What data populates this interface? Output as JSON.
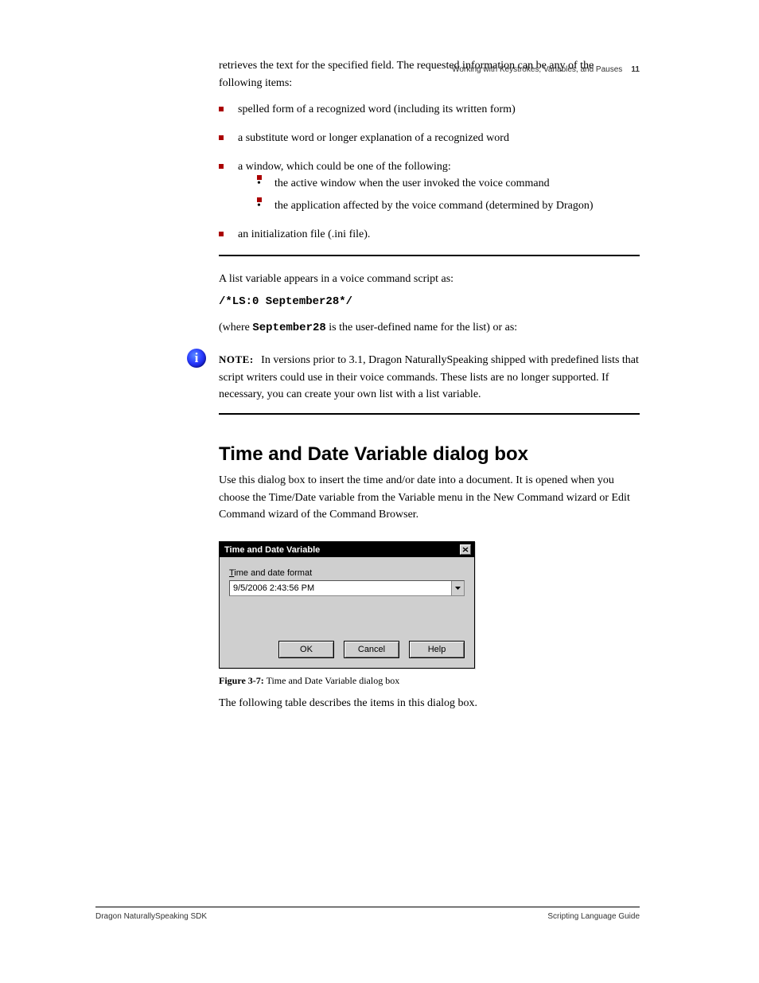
{
  "header": {
    "runner": "Working with Keystrokes, Variables, and Pauses",
    "page_number": "11"
  },
  "intro_para": "retrieves the text for the specified field. The requested information can be any of the following items:",
  "bullets_level1": [
    "spelled form of a recognized word (including its written form)",
    "a substitute word or longer explanation of a recognized word",
    "a window, which could be one of the following:"
  ],
  "bullets_level2": [
    "the active window when the user invoked the voice command",
    "the application affected by the voice command (determined by Dragon)"
  ],
  "bullet_last": "an initialization file (.ini file).",
  "list_variable_para_1": "A list variable appears in a voice command script as:",
  "list_variable_code_1": "/*LS:0 September28*/",
  "list_variable_para_2_before": "(where ",
  "list_variable_para_2_code": "September28",
  "list_variable_para_2_after": " is the user-defined name for the list) or as:",
  "note": {
    "label": "NOTE:",
    "text": "In versions prior to 3.1, Dragon NaturallySpeaking shipped with predefined lists that script writers could use in their voice commands. These lists are no longer supported. If necessary, you can create your own list with a list variable."
  },
  "section_title": "Time and Date Variable dialog box",
  "section_para": "Use this dialog box to insert the time and/or date into a document. It is opened when you choose the Time/Date variable from the Variable menu in the New Command wizard or Edit Command wizard of the Command Browser.",
  "dialog": {
    "title": "Time and Date Variable",
    "label_prefix": "T",
    "label_rest": "ime and date format",
    "value": "9/5/2006 2:43:56 PM",
    "buttons": {
      "ok": "OK",
      "cancel": "Cancel",
      "help": "Help"
    }
  },
  "figure_caption_label": "Figure 3-7:",
  "figure_caption_text": "Time and Date Variable dialog box",
  "following_text": "The following table describes the items in this dialog box.",
  "footer": {
    "left": "Dragon NaturallySpeaking SDK",
    "right": "Scripting Language Guide"
  }
}
